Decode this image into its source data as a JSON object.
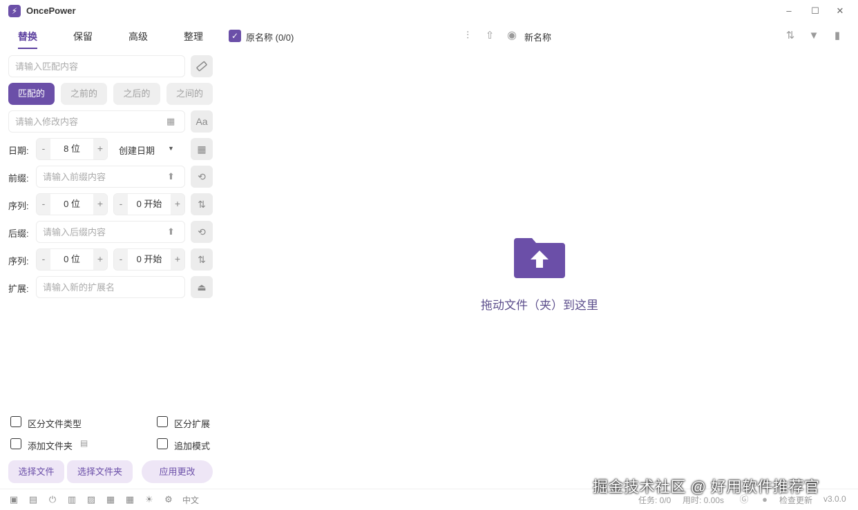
{
  "app": {
    "title": "OncePower",
    "logo_glyph": "⚡"
  },
  "window_controls": {
    "minimize": "–",
    "maximize": "☐",
    "close": "✕"
  },
  "tabs": [
    {
      "label": "替换",
      "active": true
    },
    {
      "label": "保留",
      "active": false
    },
    {
      "label": "高级",
      "active": false
    },
    {
      "label": "整理",
      "active": false
    }
  ],
  "replace": {
    "match_placeholder": "请输入匹配内容",
    "modes": [
      "匹配的",
      "之前的",
      "之后的",
      "之间的"
    ],
    "modify_placeholder": "请输入修改内容",
    "case_icon": "Aa"
  },
  "date_row": {
    "label": "日期:",
    "digits": "8 位",
    "type": "创建日期"
  },
  "prefix_row": {
    "label": "前缀:",
    "placeholder": "请输入前缀内容"
  },
  "sequence1": {
    "label": "序列:",
    "digits": "0 位",
    "start": "0 开始"
  },
  "suffix_row": {
    "label": "后缀:",
    "placeholder": "请输入后缀内容"
  },
  "sequence2": {
    "label": "序列:",
    "digits": "0 位",
    "start": "0 开始"
  },
  "ext_row": {
    "label": "扩展:",
    "placeholder": "请输入新的扩展名"
  },
  "stepper": {
    "minus": "-",
    "plus": "+"
  },
  "options": {
    "distinguish_type": "区分文件类型",
    "distinguish_ext": "区分扩展",
    "add_folder": "添加文件夹",
    "append_mode": "追加模式"
  },
  "actions": {
    "select_files": "选择文件",
    "select_folder": "选择文件夹",
    "apply": "应用更改"
  },
  "header": {
    "original_name": "原名称 (0/0)",
    "new_name": "新名称"
  },
  "drop": {
    "text": "拖动文件（夹）到这里"
  },
  "status": {
    "language": "中文",
    "tasks": "任务: 0/0",
    "time": "用时: 0.00s",
    "check_update": "检查更新",
    "version": "v3.0.0"
  },
  "watermark": "掘金技术社区 @ 好用软件推荐官",
  "colors": {
    "accent": "#6b4fa8",
    "accent_light": "#eee6f6"
  }
}
